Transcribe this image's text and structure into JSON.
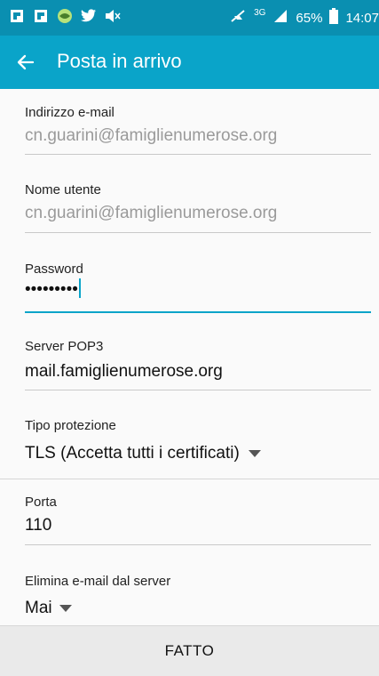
{
  "status_bar": {
    "left_icons": [
      "flipboard-icon",
      "flipboard-icon",
      "app-icon",
      "twitter-icon",
      "mute-icon"
    ],
    "right": {
      "network_type": "3G",
      "battery": "65%",
      "time": "14:07",
      "icons": [
        "silent-icon",
        "signal-icon",
        "battery-icon"
      ]
    }
  },
  "app_bar": {
    "title": "Posta in arrivo",
    "back_icon": "back-arrow-icon"
  },
  "form": {
    "email": {
      "label": "Indirizzo e-mail",
      "value": "cn.guarini@famiglienumerose.org"
    },
    "username": {
      "label": "Nome utente",
      "value": "cn.guarini@famiglienumerose.org"
    },
    "password": {
      "label": "Password",
      "value": "•••••••••"
    },
    "server": {
      "label": "Server POP3",
      "value": "mail.famiglienumerose.org"
    },
    "security": {
      "label": "Tipo protezione",
      "value": "TLS (Accetta tutti i certificati)"
    },
    "port": {
      "label": "Porta",
      "value": "110"
    },
    "delete": {
      "label": "Elimina e-mail dal server",
      "value": "Mai"
    }
  },
  "footer": {
    "done_label": "FATTO"
  },
  "colors": {
    "status_bar": "#0a8fb1",
    "app_bar": "#0aa4c9",
    "accent": "#0aa4c9"
  }
}
